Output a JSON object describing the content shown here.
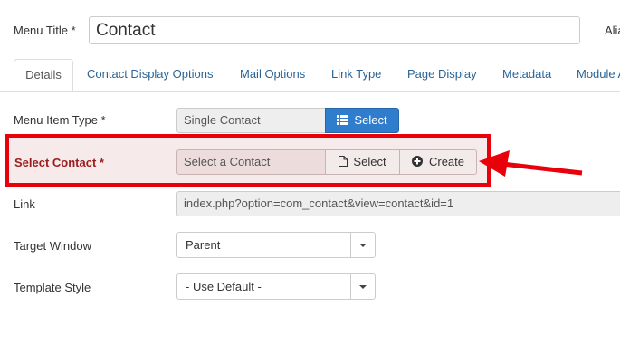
{
  "menu_title": {
    "label": "Menu Title *",
    "value": "Contact"
  },
  "alias_label": "Alia",
  "tabs": [
    {
      "label": "Details"
    },
    {
      "label": "Contact Display Options"
    },
    {
      "label": "Mail Options"
    },
    {
      "label": "Link Type"
    },
    {
      "label": "Page Display"
    },
    {
      "label": "Metadata"
    },
    {
      "label": "Module A"
    }
  ],
  "menu_item_type": {
    "label": "Menu Item Type *",
    "value": "Single Contact",
    "button": "Select"
  },
  "select_contact": {
    "label": "Select Contact *",
    "placeholder": "Select a Contact",
    "select_button": "Select",
    "create_button": "Create"
  },
  "link": {
    "label": "Link",
    "value": "index.php?option=com_contact&view=contact&id=1"
  },
  "target_window": {
    "label": "Target Window",
    "value": "Parent"
  },
  "template_style": {
    "label": "Template Style",
    "value": "- Use Default -"
  },
  "colors": {
    "accent_blue": "#2f7dcc",
    "highlight_red": "#e8000b",
    "required_label": "#9b1c1c"
  },
  "icons": [
    "list-icon",
    "file-icon",
    "plus-circle-icon",
    "dropdown-caret-icon",
    "red-arrow-annotation"
  ]
}
